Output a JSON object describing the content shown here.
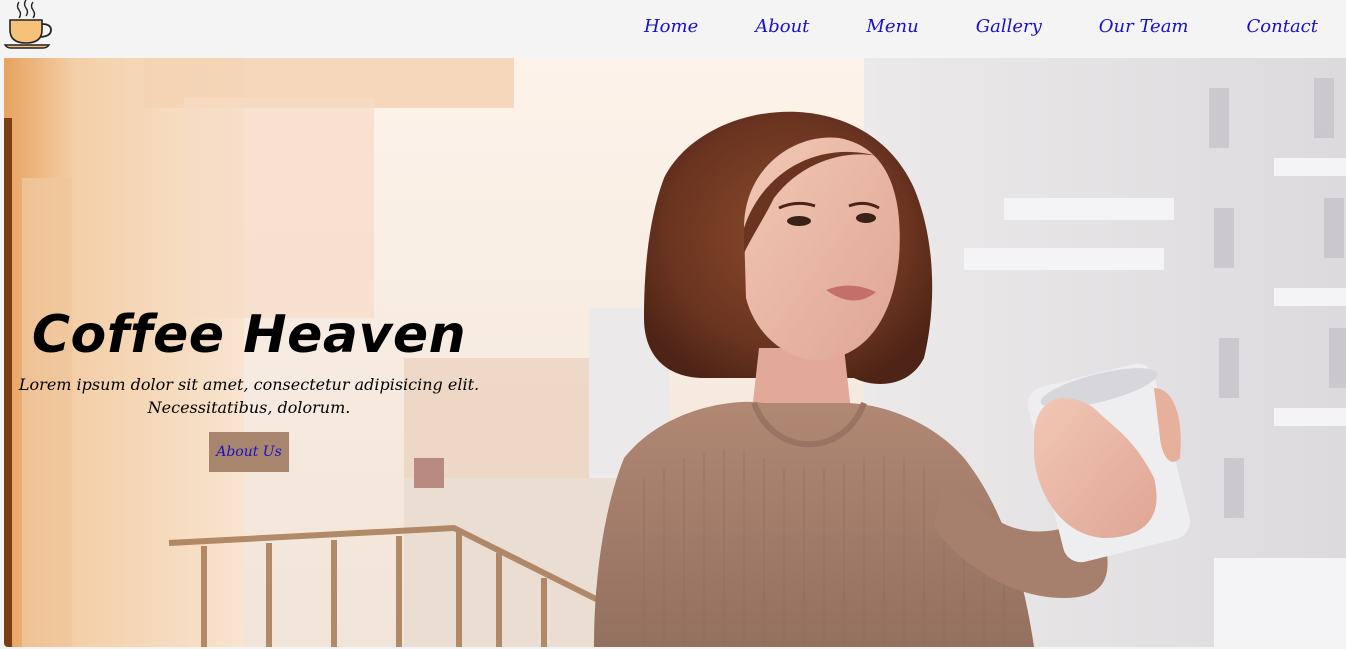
{
  "nav": {
    "logo_icon": "coffee-cup-icon",
    "links": [
      "Home",
      "About",
      "Menu",
      "Gallery",
      "Our Team",
      "Contact"
    ],
    "link_color": "#1a10c8"
  },
  "hero": {
    "title": "Coffee Heaven",
    "subtitle_line1": "Lorem ipsum dolor sit amet, consectetur adipisicing elit.",
    "subtitle_line2": "Necessitatibus, dolorum.",
    "button_label": "About Us",
    "button_color": "#a8866d"
  }
}
